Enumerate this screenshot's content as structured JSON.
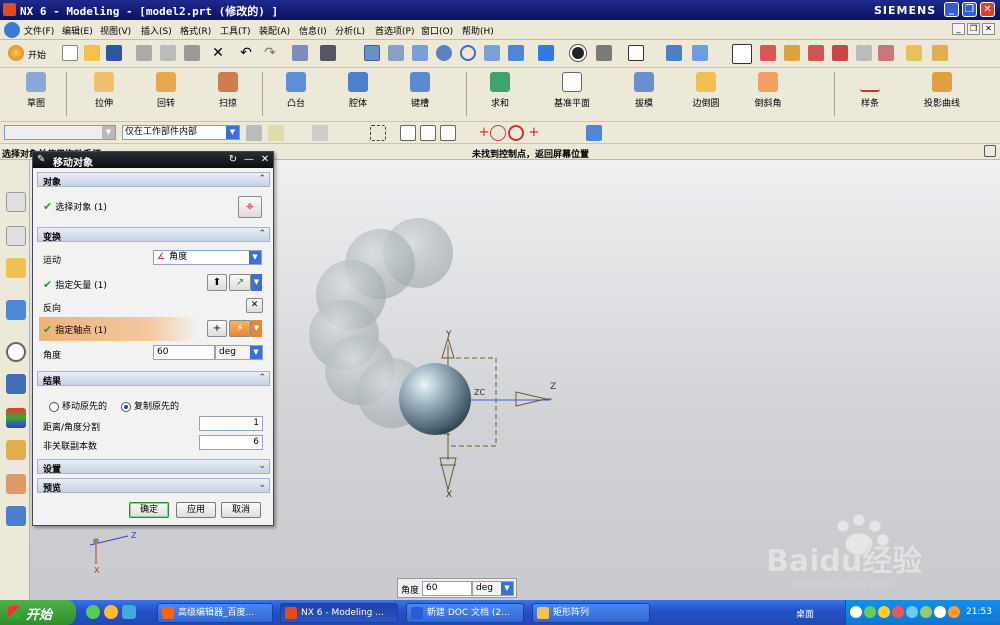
{
  "window": {
    "title": "NX 6 - Modeling - [model2.prt  (修改的) ]",
    "brand": "SIEMENS",
    "buttons": [
      "_",
      "❐",
      "✕"
    ]
  },
  "menu": {
    "items": [
      "文件(F)",
      "编辑(E)",
      "视图(V)",
      "插入(S)",
      "格式(R)",
      "工具(T)",
      "装配(A)",
      "信息(I)",
      "分析(L)",
      "首选项(P)",
      "窗口(O)",
      "帮助(H)"
    ]
  },
  "toolbar1": {
    "start_label": "开始"
  },
  "feature_toolbar": {
    "items": [
      "草图",
      "拉伸",
      "回转",
      "扫掠",
      "凸台",
      "腔体",
      "键槽",
      "求和",
      "基准平面",
      "拔模",
      "边倒圆",
      "倒斜角",
      "样条",
      "投影曲线"
    ]
  },
  "selection_bar": {
    "filter_value": "",
    "scope_value": "仅在工作部件内部"
  },
  "status": {
    "left": "选择对象并使用拖动手柄",
    "center": "未找到控制点，返回屏幕位置"
  },
  "dialog": {
    "title": "移动对象",
    "sections": {
      "object": "对象",
      "transform": "变换",
      "result": "结果",
      "settings": "设置",
      "preview": "预览"
    },
    "select_object": "选择对象 (1)",
    "motion_label": "运动",
    "motion_value": "角度",
    "vector_label": "指定矢量 (1)",
    "reverse_label": "反向",
    "pivot_label": "指定轴点 (1)",
    "angle_label": "角度",
    "angle_value": "60",
    "angle_unit": "deg",
    "move_original": "移动原先的",
    "copy_original": "复制原先的",
    "distance_label": "距离/角度分割",
    "distance_value": "1",
    "copies_label": "非关联副本数",
    "copies_value": "6",
    "ok": "确定",
    "apply": "应用",
    "cancel": "取消"
  },
  "graphics": {
    "axis_x": "X",
    "axis_y": "Y",
    "axis_z": "Z",
    "zc_label": "ZC",
    "xc_label": "XC",
    "triad_z": "Z",
    "triad_x": "X"
  },
  "angle_bar": {
    "label": "角度",
    "value": "60",
    "unit": "deg"
  },
  "watermark": {
    "brand": "Baidu经验",
    "url": "jingyan.baidu.com"
  },
  "taskbar": {
    "start": "开始",
    "tasks": [
      "高级编辑器_百度...",
      "NX 6 - Modeling ...",
      "新建 DOC 文档 (2...",
      "矩形阵列"
    ],
    "desktop": "桌面",
    "clock": "21:53"
  }
}
